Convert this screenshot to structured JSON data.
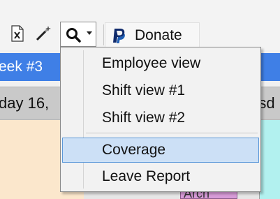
{
  "toolbar": {
    "donate_label": "Donate",
    "icons": [
      "excel-export-icon",
      "magic-wand-icon",
      "search-icon",
      "dropdown-caret-icon",
      "paypal-icon"
    ]
  },
  "week": {
    "label": "eek #3"
  },
  "day_header": {
    "left_label": "day 16,",
    "right_label": "rsd"
  },
  "calendar": {
    "shift_block_text": "Arch"
  },
  "view_menu": {
    "items": [
      {
        "label": "Employee view",
        "highlighted": false
      },
      {
        "label": "Shift view #1",
        "highlighted": false
      },
      {
        "label": "Shift view #2",
        "highlighted": false
      },
      {
        "label": "Coverage",
        "highlighted": true
      },
      {
        "label": "Leave Report",
        "highlighted": false
      }
    ]
  },
  "colors": {
    "week_band": "#3f7fe6",
    "menu_highlight": "#cce0f6",
    "menu_highlight_border": "#5b98d9",
    "day_column_left": "#fbe7cc",
    "day_column_right": "#b2f1ef",
    "shift_block": "#d79bd7"
  }
}
